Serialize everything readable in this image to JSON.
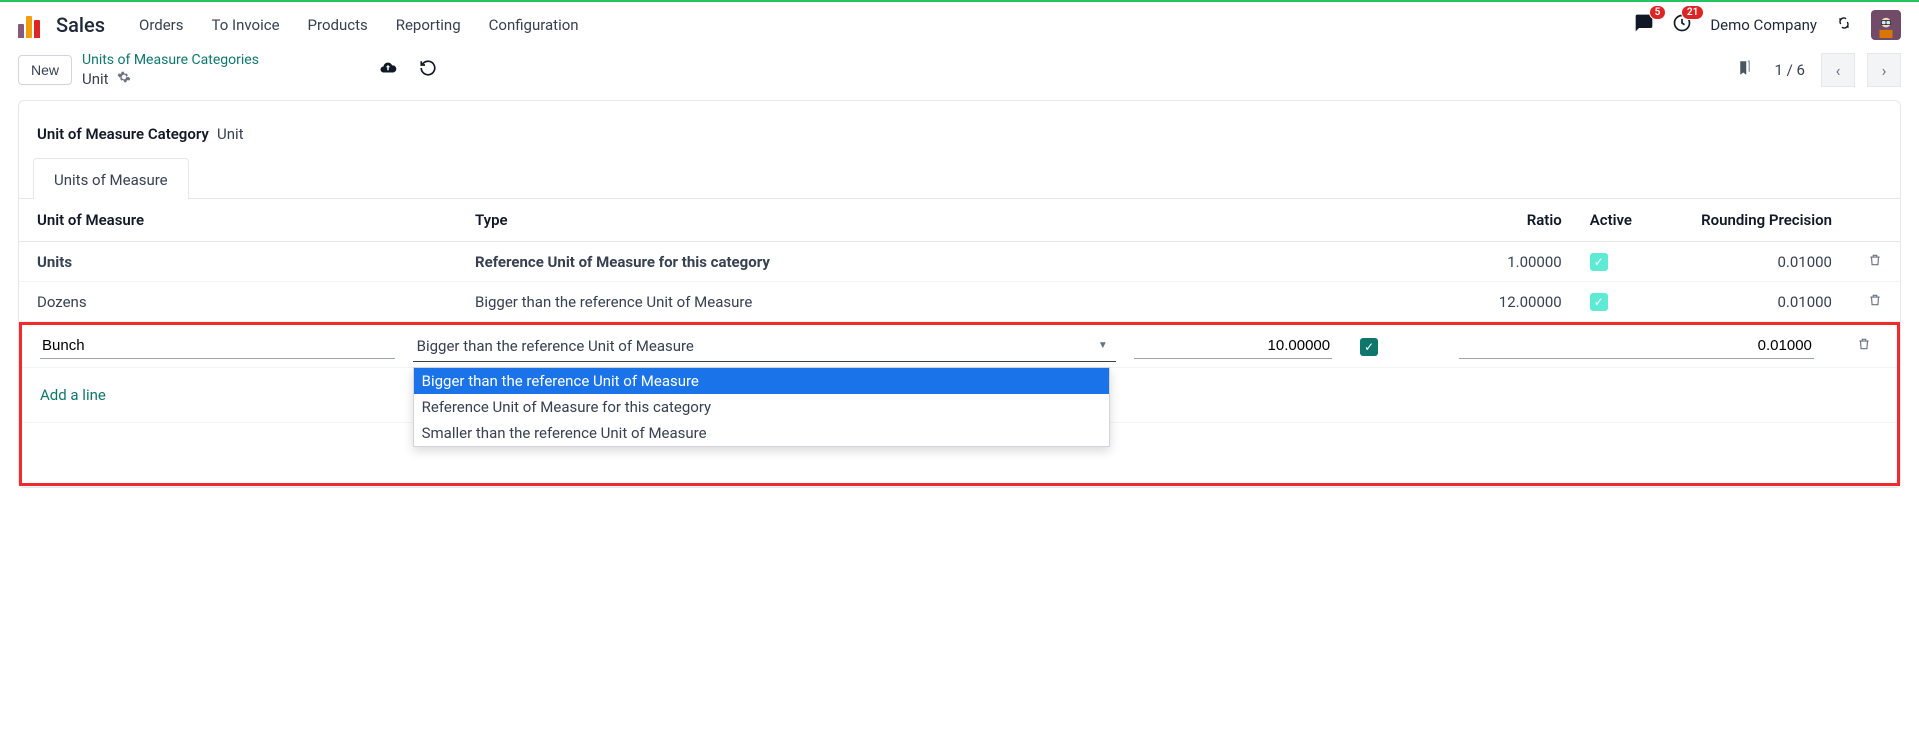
{
  "nav": {
    "app_title": "Sales",
    "items": [
      "Orders",
      "To Invoice",
      "Products",
      "Reporting",
      "Configuration"
    ],
    "messages_badge": "5",
    "activities_badge": "21",
    "company": "Demo Company"
  },
  "control": {
    "new_btn": "New",
    "breadcrumb_parent": "Units of Measure Categories",
    "breadcrumb_current": "Unit",
    "pager": "1 / 6"
  },
  "form": {
    "category_label": "Unit of Measure Category",
    "category_value": "Unit",
    "tab_label": "Units of Measure"
  },
  "table": {
    "headers": {
      "uom": "Unit of Measure",
      "type": "Type",
      "ratio": "Ratio",
      "active": "Active",
      "rounding": "Rounding Precision"
    },
    "rows": [
      {
        "name": "Units",
        "type": "Reference Unit of Measure for this category",
        "ratio": "1.00000",
        "active_dark": false,
        "rounding": "0.01000"
      },
      {
        "name": "Dozens",
        "type": "Bigger than the reference Unit of Measure",
        "ratio": "12.00000",
        "active_dark": false,
        "rounding": "0.01000"
      }
    ],
    "edit_row": {
      "name": "Bunch",
      "type": "Bigger than the reference Unit of Measure",
      "ratio": "10.00000",
      "rounding": "0.01000"
    },
    "dropdown": [
      "Bigger than the reference Unit of Measure",
      "Reference Unit of Measure for this category",
      "Smaller than the reference Unit of Measure"
    ],
    "add_line": "Add a line"
  }
}
